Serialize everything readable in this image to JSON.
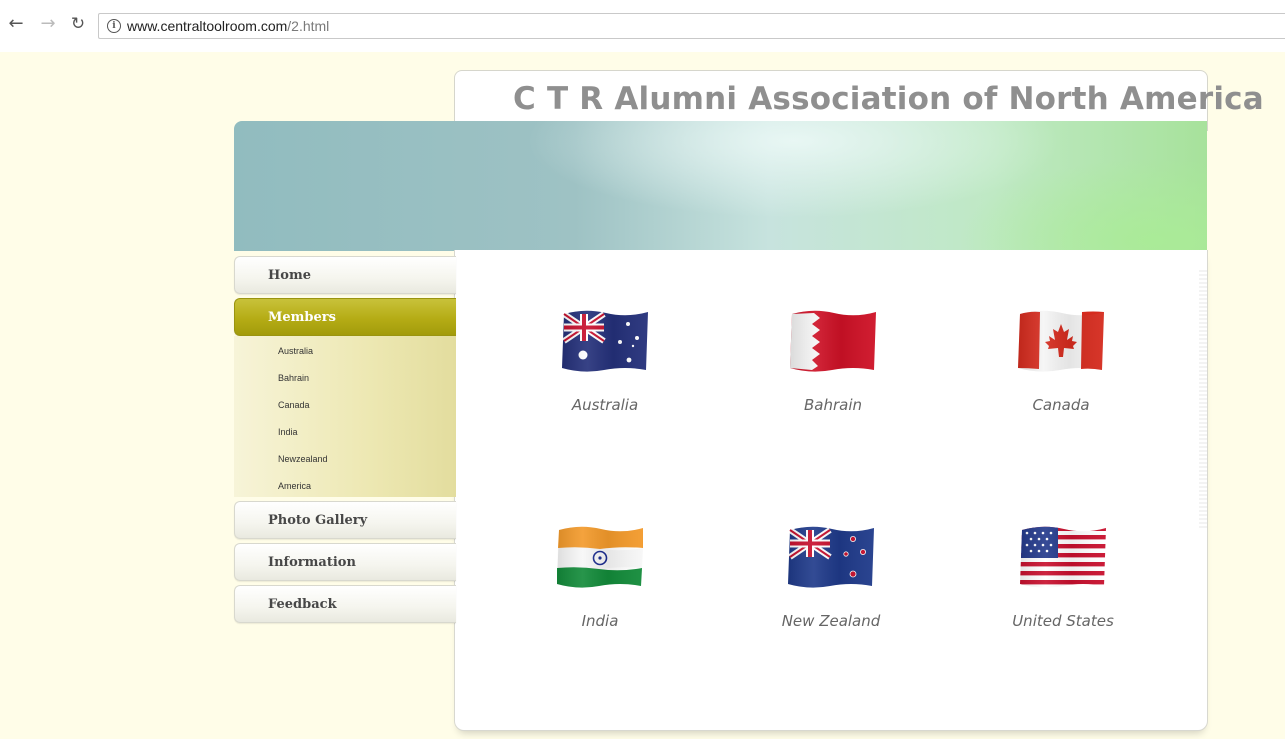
{
  "browser": {
    "url_host": "www.centraltoolroom.com",
    "url_path": "/2.html"
  },
  "site": {
    "title": "C T R Alumni Association of North America"
  },
  "sidebar": {
    "items": [
      {
        "label": "Home"
      },
      {
        "label": "Members"
      },
      {
        "label": "Photo Gallery"
      },
      {
        "label": "Information"
      },
      {
        "label": "Feedback"
      }
    ],
    "members_submenu": [
      "Australia",
      "Bahrain",
      "Canada",
      "India",
      "Newzealand",
      "America"
    ]
  },
  "flags": [
    {
      "name": "Australia",
      "icon": "australia-flag-icon"
    },
    {
      "name": "Bahrain",
      "icon": "bahrain-flag-icon"
    },
    {
      "name": "Canada",
      "icon": "canada-flag-icon"
    },
    {
      "name": "India",
      "icon": "india-flag-icon"
    },
    {
      "name": "New Zealand",
      "icon": "new-zealand-flag-icon"
    },
    {
      "name": "United States",
      "icon": "united-states-flag-icon"
    }
  ],
  "colors": {
    "page_background": "#fffde8",
    "active_nav": "#b5ac15",
    "title_text": "#8f8f8f"
  }
}
